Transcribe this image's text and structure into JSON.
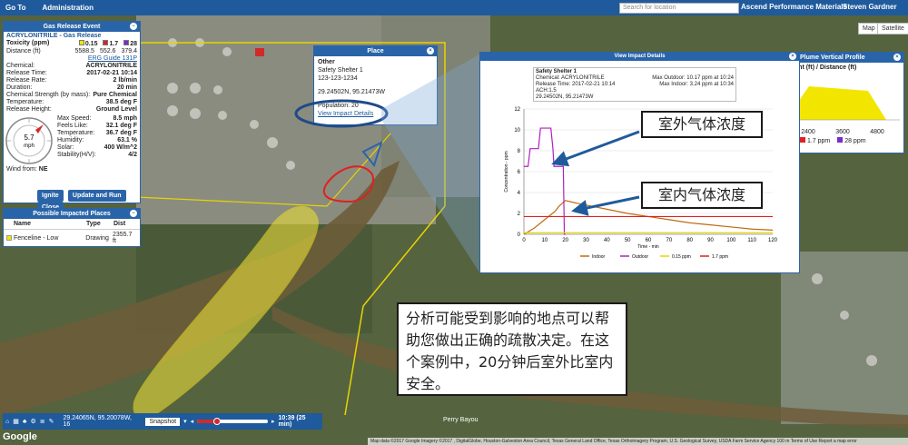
{
  "topbar": {
    "goto": "Go To",
    "admin": "Administration",
    "search_placeholder": "Search for location",
    "org": "Ascend Performance Materials",
    "user": "Steven Gardner"
  },
  "release_panel": {
    "title": "Gas Release Event",
    "chemical_title": "ACRYLONITRILE - Gas Release",
    "toxicity_label": "Toxicity (ppm)",
    "distance_label": "Distance (ft)",
    "levels": [
      {
        "ppm": "0.15",
        "distance": "5588.5",
        "color": "#f2e600"
      },
      {
        "ppm": "1.7",
        "distance": "552.6",
        "color": "#e02020"
      },
      {
        "ppm": "28",
        "distance": "379.4",
        "color": "#7a2ad0"
      }
    ],
    "erg": "ERG Guide 131P",
    "fields": [
      {
        "label": "Chemical:",
        "value": "ACRYLONITRILE"
      },
      {
        "label": "Release Time:",
        "value": "2017-02-21 10:14"
      },
      {
        "label": "Release Rate:",
        "value": "2 lb/min"
      },
      {
        "label": "Duration:",
        "value": "20 min"
      },
      {
        "label": "Chemical Strength (by mass):",
        "value": "Pure Chemical"
      },
      {
        "label": "Temperature:",
        "value": "38.5 deg F"
      },
      {
        "label": "Release Height:",
        "value": "Ground Level"
      }
    ],
    "weather": [
      {
        "label": "Max Speed:",
        "value": "8.5 mph"
      },
      {
        "label": "Feels Like:",
        "value": "32.1 deg F"
      },
      {
        "label": "Temperature:",
        "value": "36.7 deg F"
      },
      {
        "label": "Humidity:",
        "value": "63.1 %"
      },
      {
        "label": "Solar:",
        "value": "400 W/m^2"
      },
      {
        "label": "Stability(H/V):",
        "value": "4/2"
      }
    ],
    "compass_speed": "5.7",
    "compass_unit": "mph",
    "wind_from_label": "Wind from:",
    "wind_from": "NE",
    "buttons": {
      "ignite": "Ignite",
      "update": "Update and Run",
      "close": "Close"
    }
  },
  "impacted_panel": {
    "title": "Possible Impacted Places",
    "headers": [
      "Name",
      "Type",
      "Dist"
    ],
    "rows": [
      {
        "name": "Fenceline - Low",
        "type": "Drawing",
        "dist": "2355.7 ft"
      }
    ]
  },
  "place_popup": {
    "title": "Place",
    "category": "Other",
    "name": "Safety Shelter 1",
    "phone": "123-123-1234",
    "coords": "29.24502N, 95.21473W",
    "population": "Population: 20",
    "link": "View Impact Details"
  },
  "impact_panel": {
    "title": "View Impact Details",
    "name": "Safety Shelter 1",
    "chemical": "Chemical: ACRYLONITRILE",
    "release_time": "Release Time: 2017-02-21 10:14",
    "ach": "ACH:1.5",
    "coords": "29.24502N, 95.21473W",
    "max_outdoor": "Max Outdoor: 10.17 ppm at 10:24",
    "max_indoor": "Max Indoor: 3.24 ppm at 10:34"
  },
  "chart_data": {
    "type": "line",
    "xlabel": "Time - min",
    "ylabel": "Concentration - ppm",
    "xlim": [
      0,
      120
    ],
    "ylim": [
      0,
      12
    ],
    "xticks": [
      0,
      10,
      20,
      30,
      40,
      50,
      60,
      70,
      80,
      90,
      100,
      110,
      120
    ],
    "yticks": [
      0,
      2,
      4,
      6,
      8,
      10,
      12
    ],
    "series": [
      {
        "name": "Indoor",
        "color": "#c06a10",
        "x": [
          0,
          5,
          10,
          15,
          17,
          20,
          25,
          30,
          40,
          50,
          60,
          70,
          80,
          90,
          100,
          110,
          120
        ],
        "y": [
          0,
          0.6,
          1.4,
          2.2,
          2.7,
          3.24,
          3.0,
          2.8,
          2.4,
          2.0,
          1.7,
          1.4,
          1.1,
          0.9,
          0.7,
          0.5,
          0.4
        ]
      },
      {
        "name": "Outdoor",
        "color": "#b020c0",
        "x": [
          0,
          0.5,
          2,
          3,
          4,
          5,
          7,
          8,
          9,
          10,
          12,
          13,
          14,
          14.5,
          19,
          19.5,
          20
        ],
        "y": [
          6.5,
          6.5,
          6.5,
          8.2,
          8.2,
          8.2,
          8.2,
          10.17,
          10.17,
          10.17,
          10.17,
          10.17,
          8.2,
          6.5,
          6.5,
          0,
          0
        ]
      },
      {
        "name": "0.15 ppm",
        "color": "#e6d600",
        "x": [
          0,
          120
        ],
        "y": [
          0.15,
          0.15
        ]
      },
      {
        "name": "1.7 ppm",
        "color": "#e02020",
        "x": [
          0,
          120
        ],
        "y": [
          1.7,
          1.7
        ]
      }
    ]
  },
  "vertical_profile": {
    "title": "Plume Vertical Profile",
    "axis_label": "Height (ft) / Distance (ft)",
    "ticks": [
      "2400",
      "3600",
      "4800"
    ],
    "legend": [
      "1.7 ppm",
      "28 ppm"
    ]
  },
  "annotations": {
    "outdoor": "室外气体浓度",
    "indoor": "室内气体浓度",
    "caption": "分析可能受到影响的地点可以帮助您做出正确的疏散决定。在这个案例中，20分钟后室外比室内安全。"
  },
  "toolbar": {
    "coords": "29.24065N, 95.20078W, 16",
    "snapshot": "Snapshot",
    "time": "10:39 (25 min)"
  },
  "map": {
    "map_btn": "Map",
    "satellite_btn": "Satellite",
    "label_bayou": "Perry Bayou",
    "google": "Google",
    "attribution": "Map data ©2017 Google Imagery ©2017 , DigitalGlobe, Houston-Galveston Area Council, Texas General Land Office, Texas Orthoimagery Program, U.S. Geological Survey, USDA Farm Service Agency   100 m   Terms of Use   Report a map error"
  }
}
